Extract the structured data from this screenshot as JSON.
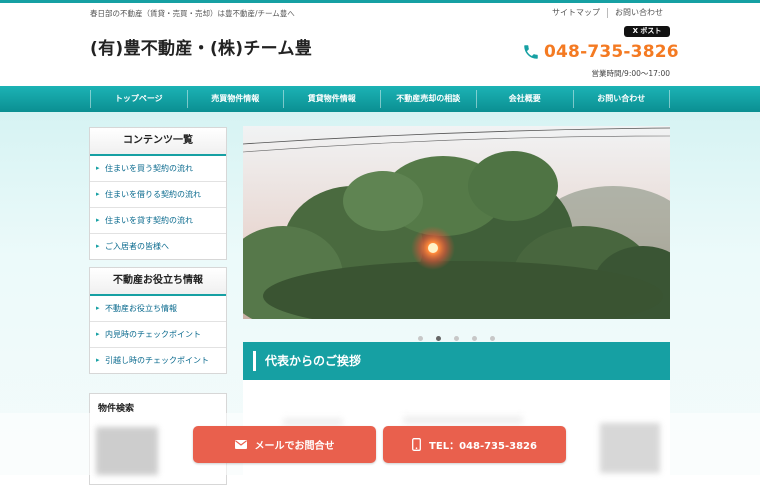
{
  "header": {
    "tagline": "春日部の不動産（賃貸・売買・売却）は豊不動産/チーム豊へ",
    "site_title": "(有)豊不動産・(株)チーム豊",
    "top_links": [
      "サイトマップ",
      "お問い合わせ"
    ],
    "x_post_label": "X ポスト",
    "phone": "048-735-3826",
    "hours": "営業時間/9:00～17:00"
  },
  "nav": {
    "items": [
      "トップページ",
      "売買物件情報",
      "賃貸物件情報",
      "不動産売却の相談",
      "会社概要",
      "お問い合わせ"
    ]
  },
  "sidebar": {
    "contents": {
      "title": "コンテンツ一覧",
      "items": [
        "住まいを買う契約の流れ",
        "住まいを借りる契約の流れ",
        "住まいを貸す契約の流れ",
        "ご入居者の皆様へ"
      ]
    },
    "tips": {
      "title": "不動産お役立ち情報",
      "items": [
        "不動産お役立ち情報",
        "内見時のチェックポイント",
        "引越し時のチェックポイント"
      ]
    },
    "search": {
      "title": "物件検索"
    }
  },
  "slider": {
    "slide_count": 5,
    "active_index": 1
  },
  "main": {
    "greeting_title": "代表からのご挨拶"
  },
  "footer": {
    "mail_label": "メールでお問合せ",
    "tel_label": "TEL：048-735-3826"
  },
  "colors": {
    "accent": "#16a0a3",
    "phone": "#f47a22",
    "cta": "#e9604d"
  }
}
